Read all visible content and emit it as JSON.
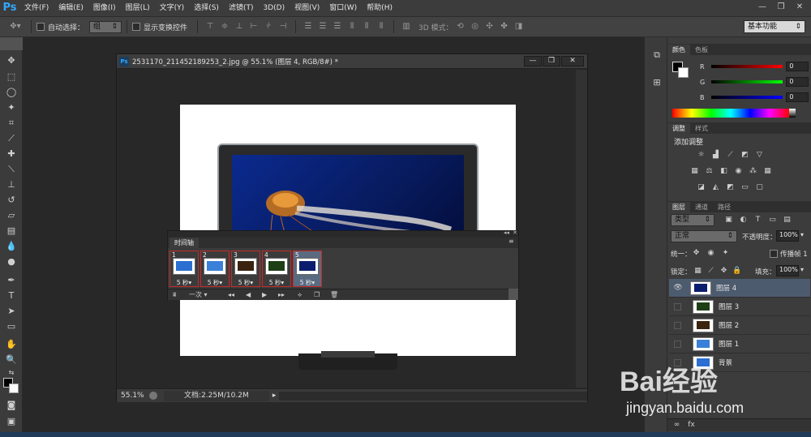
{
  "app": {
    "logo": "Ps",
    "accent": "#31a8ff"
  },
  "menu": [
    "文件(F)",
    "编辑(E)",
    "图像(I)",
    "图层(L)",
    "文字(Y)",
    "选择(S)",
    "滤镜(T)",
    "3D(D)",
    "视图(V)",
    "窗口(W)",
    "帮助(H)"
  ],
  "window_controls": {
    "minimize": "—",
    "restore": "❐",
    "close": "✕"
  },
  "options": {
    "auto_select_label": "自动选择：",
    "auto_select_value": "组",
    "show_transform_label": "显示变换控件",
    "mode_3d_label": "3D 模式：",
    "workspace": "基本功能"
  },
  "document": {
    "title": "2531170_211452189253_2.jpg @ 55.1% (图层 4, RGB/8#) *",
    "zoom": "55.1%",
    "doc_info": "文档:2.25M/10.2M"
  },
  "timeline": {
    "title": "时间轴",
    "frames": [
      {
        "num": "1",
        "time": "5 秒▾"
      },
      {
        "num": "2",
        "time": "5 秒▾"
      },
      {
        "num": "3",
        "time": "5 秒▾"
      },
      {
        "num": "4",
        "time": "5 秒▾"
      },
      {
        "num": "5",
        "time": "5 秒▾"
      }
    ],
    "loop": "一次"
  },
  "color_panel": {
    "tabs": [
      "颜色",
      "色板"
    ],
    "r_label": "R",
    "r_value": "0",
    "g_label": "G",
    "g_value": "0",
    "b_label": "B",
    "b_value": "0"
  },
  "adjust_panel": {
    "tabs": [
      "调整",
      "样式"
    ],
    "title": "添加调整"
  },
  "layers_panel": {
    "tabs": [
      "图层",
      "通道",
      "路径"
    ],
    "filter": "类型",
    "blend_mode": "正常",
    "opacity_label": "不透明度：",
    "opacity_value": "100%",
    "unify_label": "统一：",
    "propagate_label": "传播帧 1",
    "lock_label": "锁定：",
    "fill_label": "填充：",
    "fill_value": "100%",
    "layers": [
      {
        "name": "图层 4",
        "selected": true,
        "visible": true
      },
      {
        "name": "图层 3",
        "selected": false,
        "visible": false
      },
      {
        "name": "图层 2",
        "selected": false,
        "visible": false
      },
      {
        "name": "图层 1",
        "selected": false,
        "visible": false
      },
      {
        "name": "背景",
        "selected": false,
        "visible": false
      }
    ]
  },
  "watermark": {
    "text": "Bai经验",
    "url": "jingyan.baidu.com"
  }
}
